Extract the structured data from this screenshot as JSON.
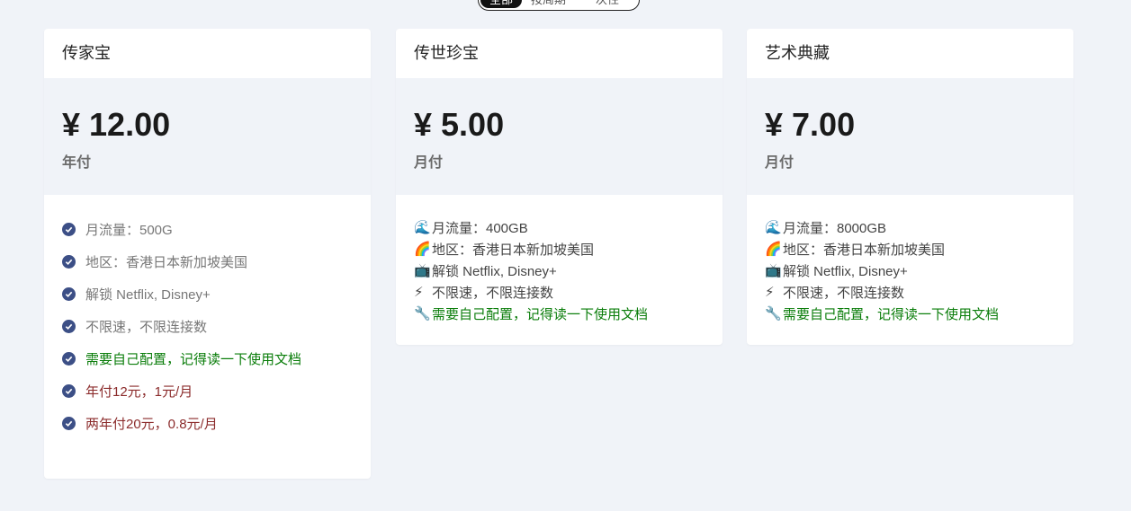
{
  "filter": {
    "options": [
      "全部",
      "按周期",
      "一次性"
    ],
    "active_index": 0
  },
  "plans": [
    {
      "title": "传家宝",
      "price": "¥ 12.00",
      "period": "年付",
      "features": [
        {
          "text": "月流量：500G",
          "color": "#777777"
        },
        {
          "text": "地区：香港日本新加坡美国",
          "color": "#777777"
        },
        {
          "text": "解锁 Netflix, Disney+",
          "color": "#777777"
        },
        {
          "text": "不限速，不限连接数",
          "color": "#777777"
        },
        {
          "text": "需要自己配置，记得读一下使用文档",
          "color": "#0a7d0a"
        },
        {
          "text": "年付12元，1元/月",
          "color": "#8b2b2b"
        },
        {
          "text": "两年付20元，0.8元/月",
          "color": "#8b2b2b"
        }
      ]
    },
    {
      "title": "传世珍宝",
      "price": "¥ 5.00",
      "period": "月付",
      "features": [
        {
          "icon": "wave-icon",
          "glyph": "🌊",
          "text": "月流量：400GB"
        },
        {
          "icon": "rainbow-icon",
          "glyph": "🌈",
          "text": "地区：香港日本新加坡美国"
        },
        {
          "icon": "tv-icon",
          "glyph": "📺",
          "text": "解锁 Netflix, Disney+"
        },
        {
          "icon": "lightning-icon",
          "glyph": "⚡",
          "text": "不限速，不限连接数"
        },
        {
          "icon": "wrench-icon",
          "glyph": "🔧",
          "text": "需要自己配置，记得读一下使用文档",
          "color": "#0a7d0a"
        }
      ]
    },
    {
      "title": "艺术典藏",
      "price": "¥ 7.00",
      "period": "月付",
      "features": [
        {
          "icon": "wave-icon",
          "glyph": "🌊",
          "text": "月流量：8000GB"
        },
        {
          "icon": "rainbow-icon",
          "glyph": "🌈",
          "text": "地区：香港日本新加坡美国"
        },
        {
          "icon": "tv-icon",
          "glyph": "📺",
          "text": "解锁 Netflix, Disney+"
        },
        {
          "icon": "lightning-icon",
          "glyph": "⚡",
          "text": "不限速，不限连接数"
        },
        {
          "icon": "wrench-icon",
          "glyph": "🔧",
          "text": "需要自己配置，记得读一下使用文档",
          "color": "#0a7d0a"
        }
      ]
    }
  ],
  "colors": {
    "background": "#f0f3f8",
    "check": "#3c4f86",
    "accent_green": "#0a7d0a",
    "accent_red": "#8b2b2b"
  }
}
